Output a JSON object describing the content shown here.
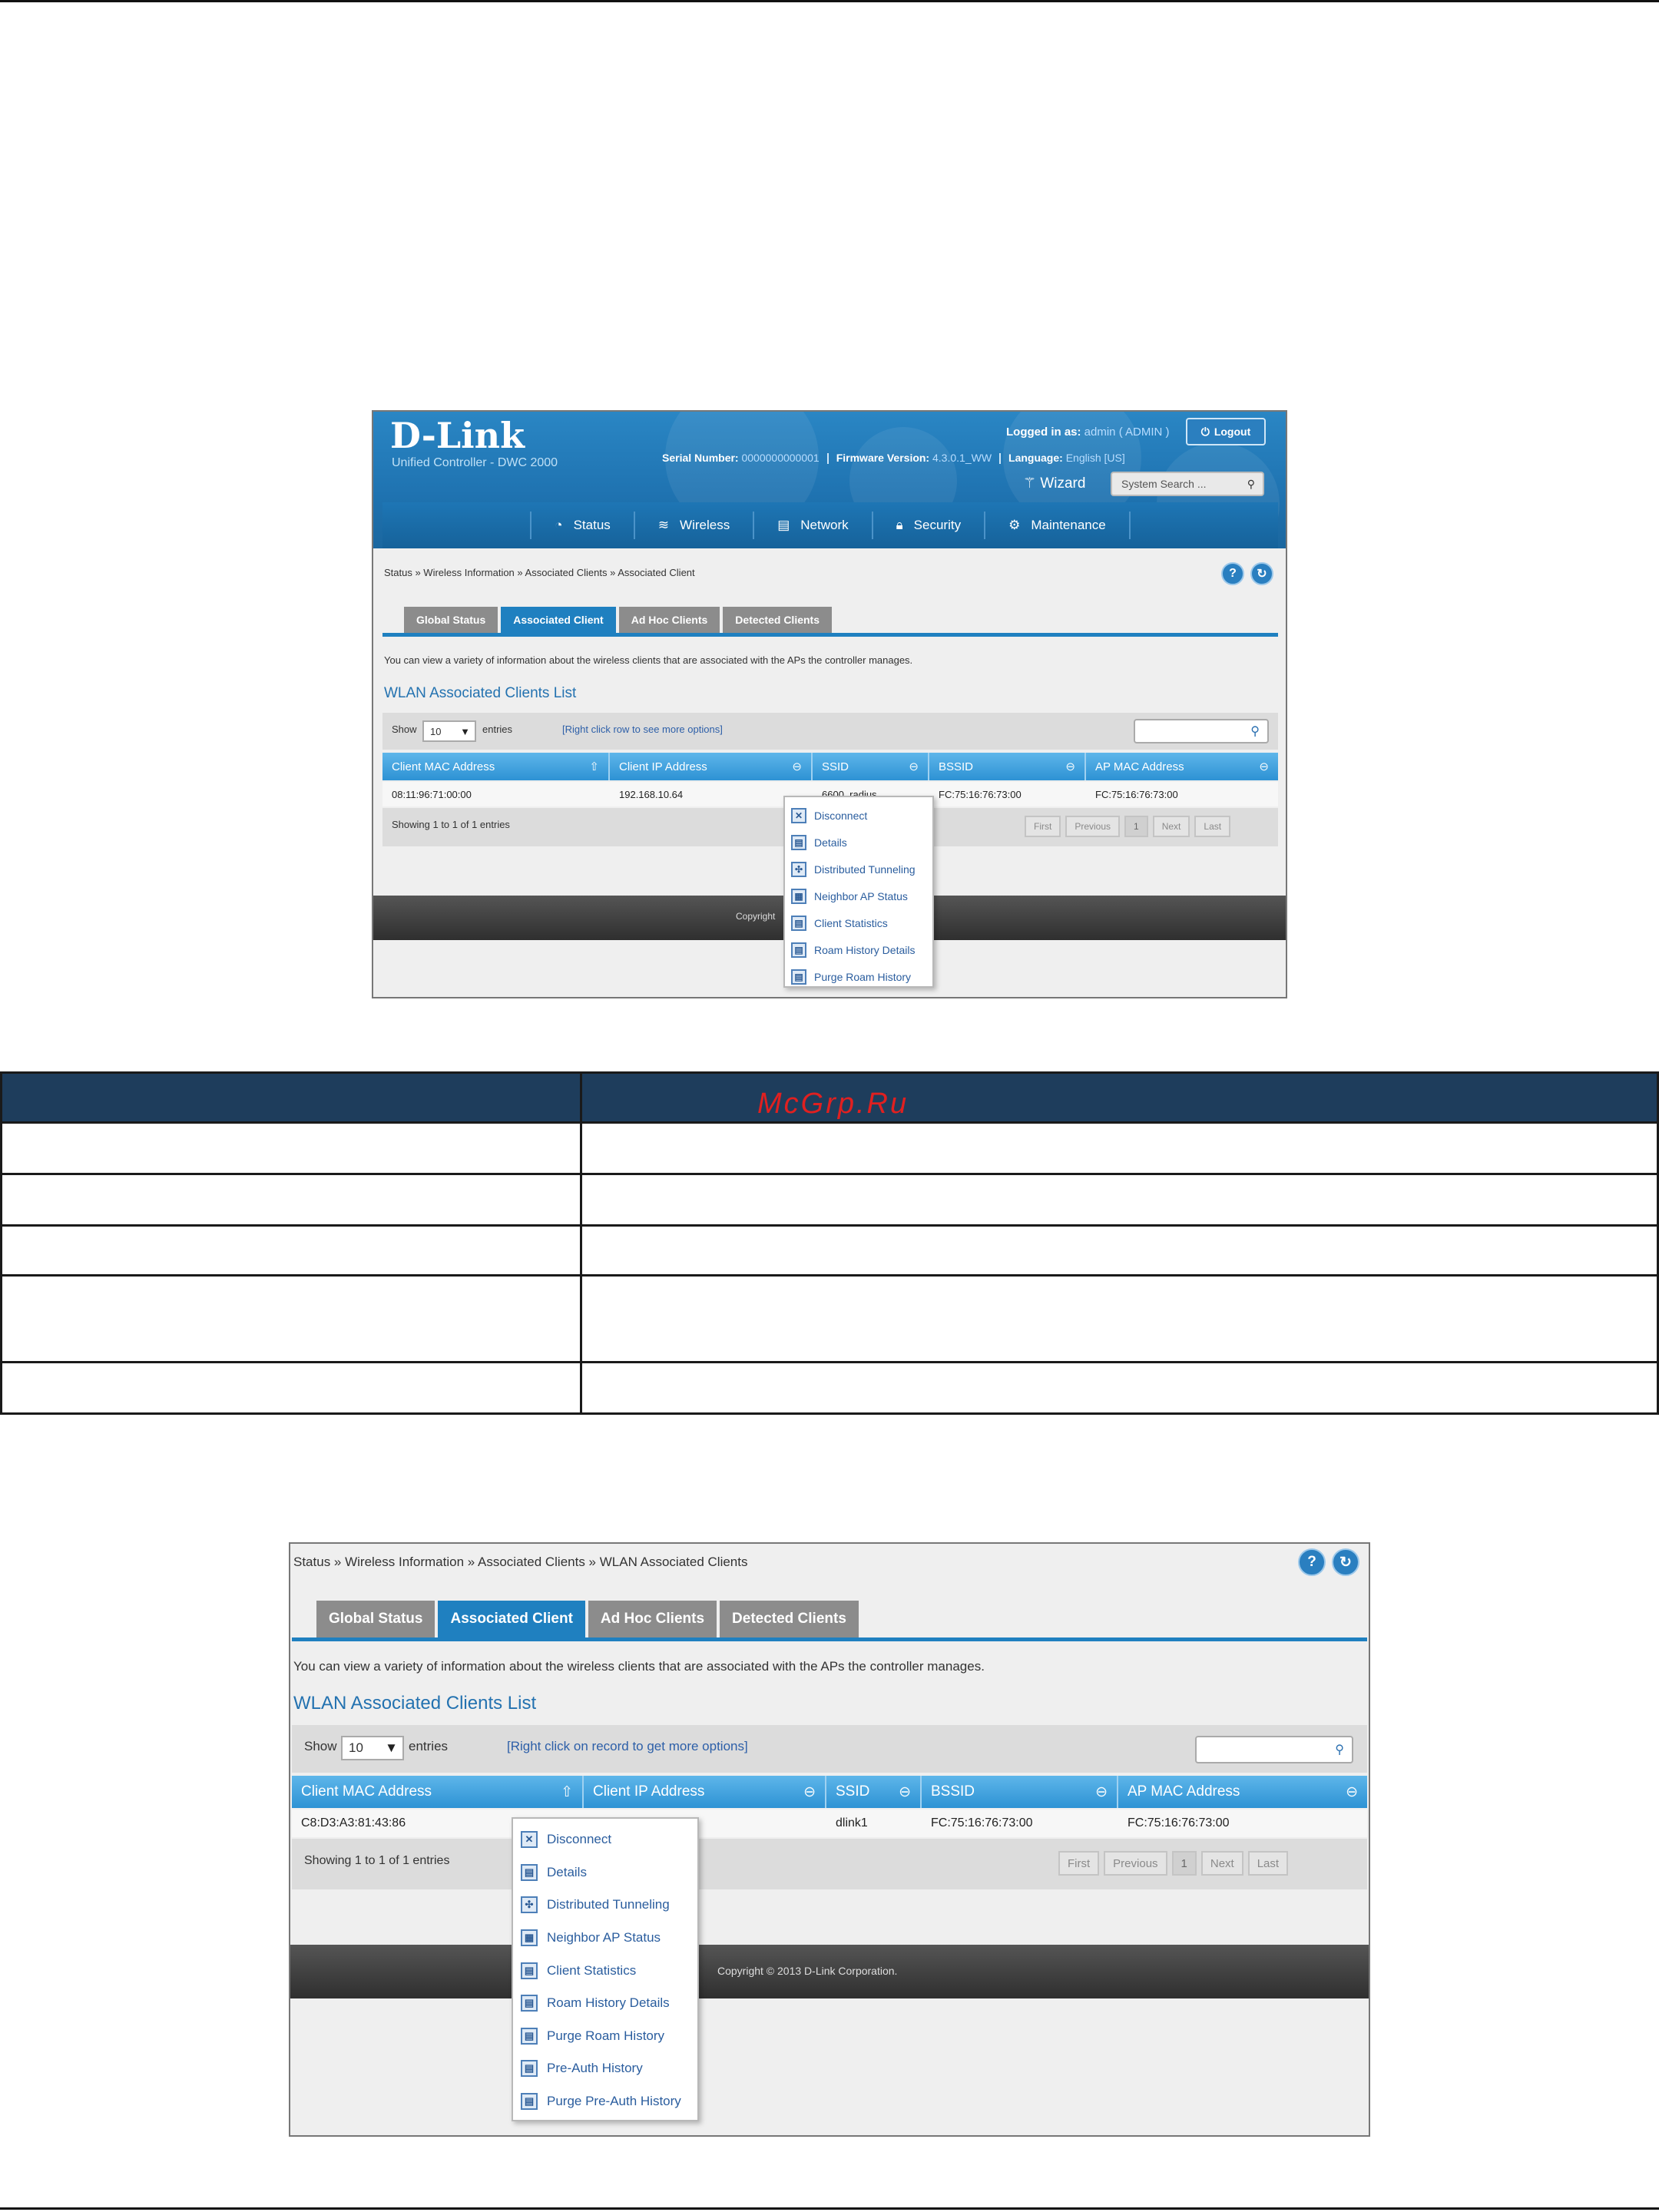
{
  "shot1": {
    "brand": "D-Link",
    "brand_sub": "Unified Controller - DWC 2000",
    "logged_label": "Logged in as:",
    "logged_user": "admin ( ADMIN )",
    "logout": "Logout",
    "serial_label": "Serial Number:",
    "serial_value": "0000000000001",
    "fw_label": "Firmware Version:",
    "fw_value": "4.3.0.1_WW",
    "lang_label": "Language:",
    "lang_value": "English [US]",
    "wizard": "Wizard",
    "search_placeholder": "System Search ...",
    "nav": [
      "Status",
      "Wireless",
      "Network",
      "Security",
      "Maintenance"
    ],
    "breadcrumb": "Status  »  Wireless Information  »  Associated Clients  »  Associated Client",
    "tabs": [
      "Global Status",
      "Associated Client",
      "Ad Hoc Clients",
      "Detected Clients"
    ],
    "description": "You can view a variety of information about the wireless clients that are associated with the APs the controller manages.",
    "list_title": "WLAN Associated Clients List",
    "show": "Show",
    "show_value": "10",
    "entries": "entries",
    "hint": "[Right click row to see more options]",
    "columns": [
      "Client MAC Address",
      "Client IP Address",
      "SSID",
      "BSSID",
      "AP MAC Address"
    ],
    "row": [
      "08:11:96:71:00:00",
      "192.168.10.64",
      "6600_radius",
      "FC:75:16:76:73:00",
      "FC:75:16:76:73:00"
    ],
    "showing": "Showing 1 to 1 of 1 entries",
    "pager": [
      "First",
      "Previous",
      "1",
      "Next",
      "Last"
    ],
    "copyright": "Copyright",
    "menu": [
      "Disconnect",
      "Details",
      "Distributed Tunneling",
      "Neighbor AP Status",
      "Client Statistics",
      "Roam History Details",
      "Purge Roam History"
    ]
  },
  "watermark": "McGrp.Ru",
  "shot2": {
    "breadcrumb": "Status  »  Wireless Information  »  Associated Clients  »  WLAN Associated Clients",
    "tabs": [
      "Global Status",
      "Associated Client",
      "Ad Hoc Clients",
      "Detected Clients"
    ],
    "description": "You can view a variety of information about the wireless clients that are associated with the APs the controller manages.",
    "list_title": "WLAN Associated Clients List",
    "show": "Show",
    "show_value": "10",
    "entries": "entries",
    "hint": "[Right click on record to get more options]",
    "columns": [
      "Client MAC Address",
      "Client IP Address",
      "SSID",
      "BSSID",
      "AP MAC Address"
    ],
    "row": [
      "C8:D3:A3:81:43:86",
      "",
      "dlink1",
      "FC:75:16:76:73:00",
      "FC:75:16:76:73:00"
    ],
    "showing": "Showing 1 to 1 of 1 entries",
    "pager": [
      "First",
      "Previous",
      "1",
      "Next",
      "Last"
    ],
    "copyright": "Copyright © 2013 D-Link Corporation.",
    "menu": [
      "Disconnect",
      "Details",
      "Distributed Tunneling",
      "Neighbor AP Status",
      "Client Statistics",
      "Roam History Details",
      "Purge Roam History",
      "Pre-Auth History",
      "Purge Pre-Auth History"
    ]
  }
}
